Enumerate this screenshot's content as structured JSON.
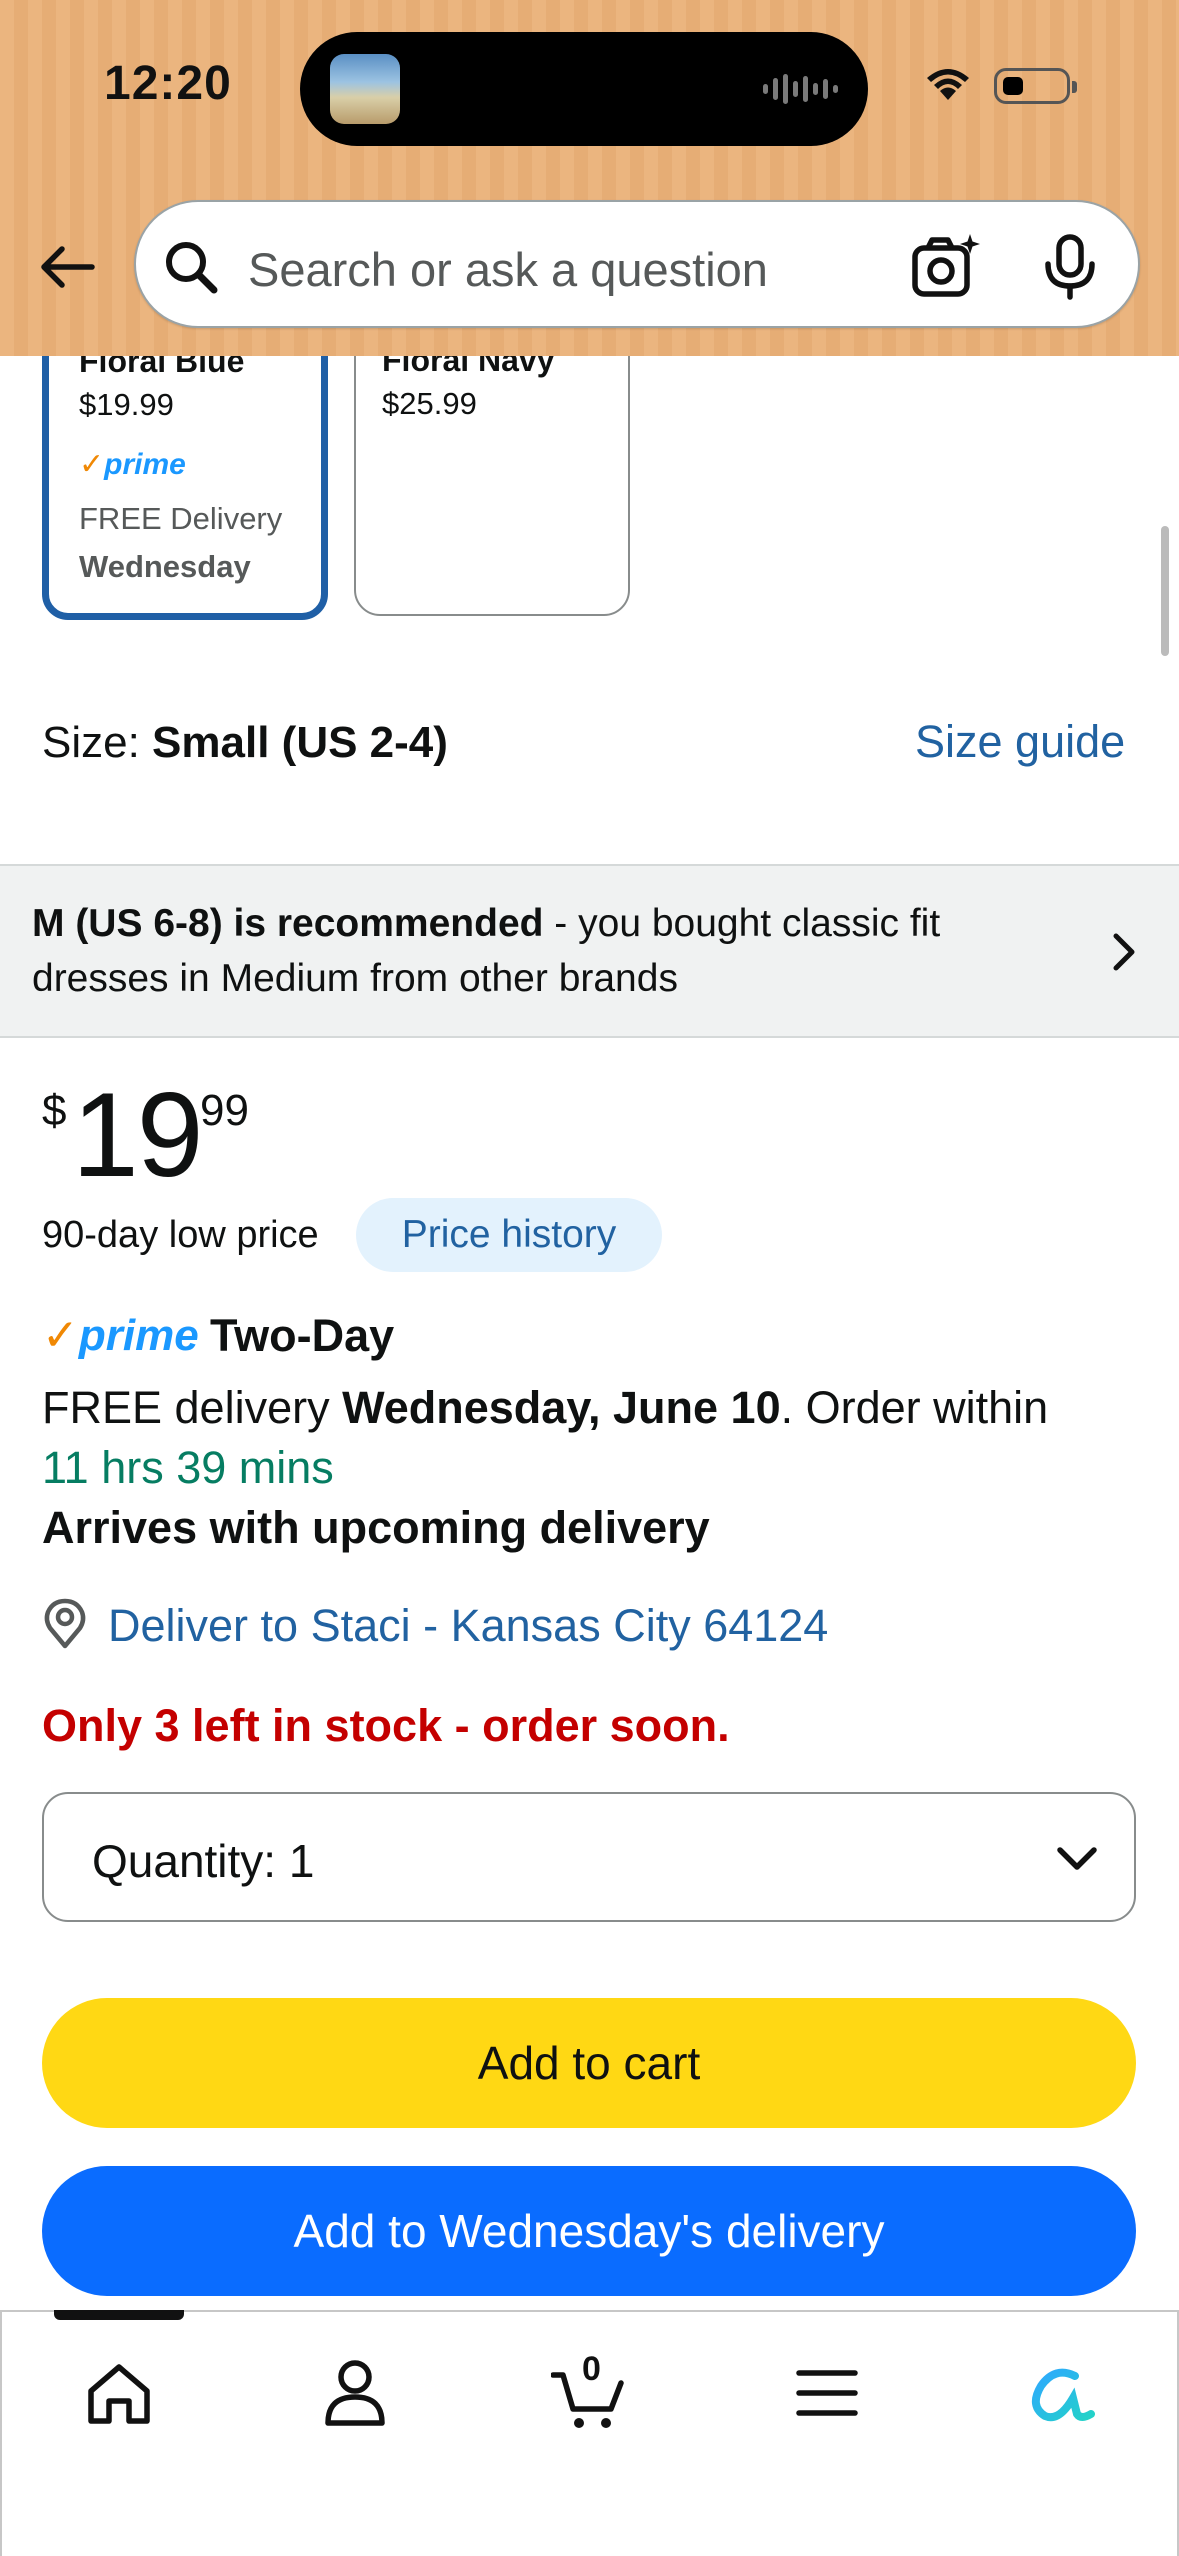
{
  "status_bar": {
    "time": "12:20"
  },
  "header": {
    "search_placeholder": "Search or ask a question",
    "colors": {
      "background": "#ebb57f"
    }
  },
  "variations": [
    {
      "name": "Floral Blue",
      "price": "$19.99",
      "prime": "prime",
      "delivery": "FREE Delivery",
      "day": "Wednesday",
      "selected": true
    },
    {
      "name": "Floral Navy",
      "price": "$25.99",
      "selected": false
    }
  ],
  "size": {
    "label": "Size: ",
    "value": "Small (US 2-4)",
    "guide_link": "Size guide"
  },
  "recommendation": {
    "bold": "M (US 6-8) is recommended",
    "rest": " - you bought classic fit dresses in Medium from other brands"
  },
  "price": {
    "symbol": "$",
    "whole": "19",
    "fraction": "99",
    "low_price_label": "90-day low price",
    "history_button": "Price history"
  },
  "delivery": {
    "prime_label": "prime",
    "speed": "Two-Day",
    "free_prefix": "FREE delivery ",
    "date": "Wednesday, June 10",
    "order_within": ". Order within",
    "countdown": "11 hrs 39 mins",
    "upcoming": "Arrives with upcoming delivery",
    "deliver_to": "Deliver to Staci - Kansas City 64124"
  },
  "stock": "Only 3 left in stock - order soon.",
  "quantity": {
    "label": "Quantity:",
    "value": "1"
  },
  "buttons": {
    "add_to_cart": "Add to cart",
    "add_to_delivery": "Add to Wednesday's delivery"
  },
  "bottom_nav": {
    "items": [
      "home-icon",
      "account-icon",
      "cart-icon",
      "menu-icon",
      "rufus-icon"
    ],
    "cart_count": "0"
  },
  "colors": {
    "link": "#2162a1",
    "prime_blue": "#1a98ff",
    "success_green": "#067d62",
    "alert_red": "#c40000",
    "cart_yellow": "#ffd814",
    "delivery_blue": "#0a6cff",
    "selected_border": "#1f5fa6"
  }
}
